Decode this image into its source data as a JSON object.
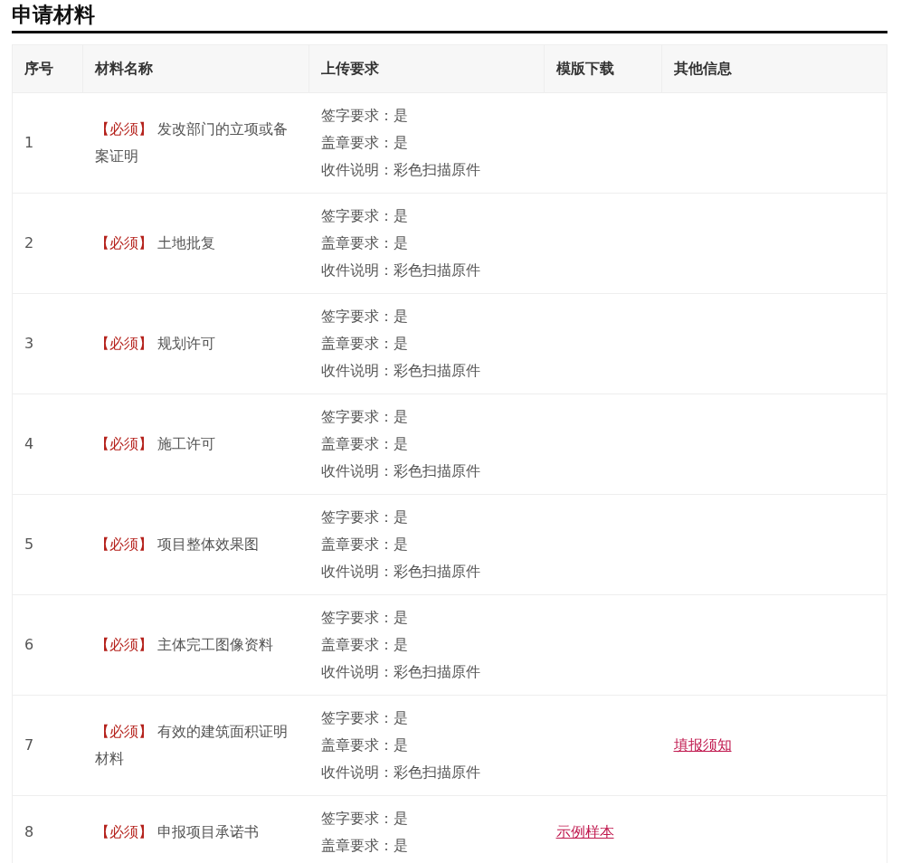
{
  "section_title": "申请材料",
  "table": {
    "columns": [
      "序号",
      "材料名称",
      "上传要求",
      "模版下载",
      "其他信息"
    ],
    "rows": [
      {
        "no": "1",
        "tag": "【必须】",
        "name": "发改部门的立项或备案证明",
        "requirements": [
          "签字要求：是",
          "盖章要求：是",
          "收件说明：彩色扫描原件"
        ]
      },
      {
        "no": "2",
        "tag": "【必须】",
        "name": "土地批复",
        "requirements": [
          "签字要求：是",
          "盖章要求：是",
          "收件说明：彩色扫描原件"
        ]
      },
      {
        "no": "3",
        "tag": "【必须】",
        "name": "规划许可",
        "requirements": [
          "签字要求：是",
          "盖章要求：是",
          "收件说明：彩色扫描原件"
        ]
      },
      {
        "no": "4",
        "tag": "【必须】",
        "name": "施工许可",
        "requirements": [
          "签字要求：是",
          "盖章要求：是",
          "收件说明：彩色扫描原件"
        ]
      },
      {
        "no": "5",
        "tag": "【必须】",
        "name": "项目整体效果图",
        "requirements": [
          "签字要求：是",
          "盖章要求：是",
          "收件说明：彩色扫描原件"
        ]
      },
      {
        "no": "6",
        "tag": "【必须】",
        "name": "主体完工图像资料",
        "requirements": [
          "签字要求：是",
          "盖章要求：是",
          "收件说明：彩色扫描原件"
        ]
      },
      {
        "no": "7",
        "tag": "【必须】",
        "name": "有效的建筑面积证明材料",
        "requirements": [
          "签字要求：是",
          "盖章要求：是",
          "收件说明：彩色扫描原件"
        ],
        "other_link": "填报须知"
      },
      {
        "no": "8",
        "tag": "【必须】",
        "name": "申报项目承诺书",
        "requirements": [
          "签字要求：是",
          "盖章要求：是"
        ],
        "template_link": "示例样本"
      }
    ]
  }
}
